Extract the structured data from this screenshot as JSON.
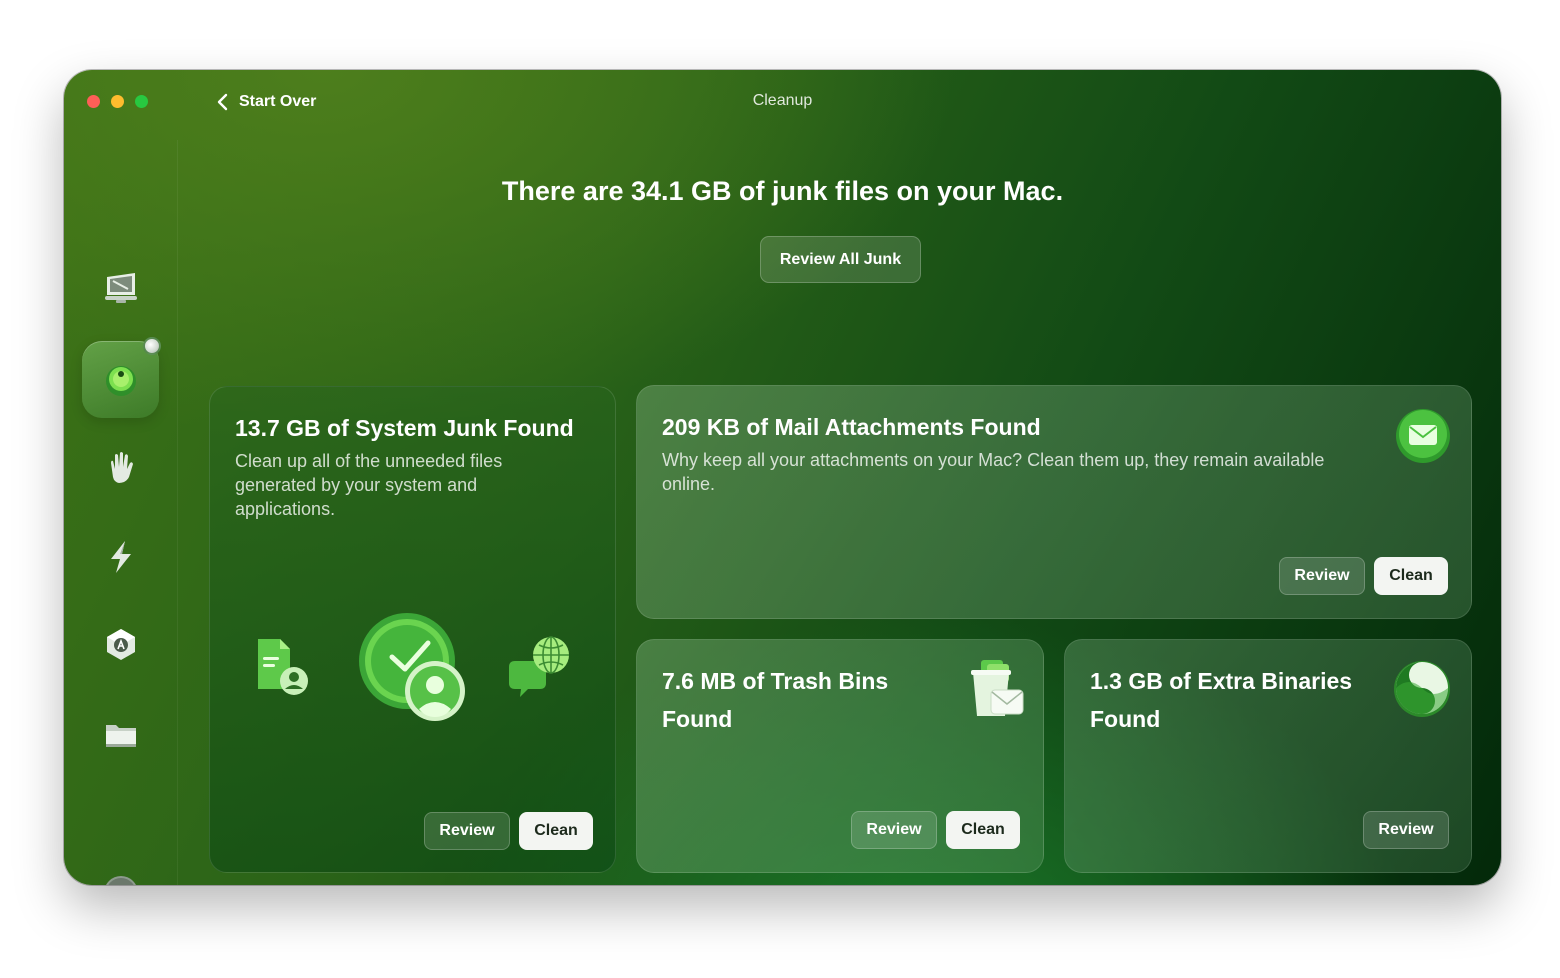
{
  "window": {
    "title": "Cleanup",
    "back_label": "Start Over"
  },
  "sidebar": {
    "items": [
      {
        "name": "system-overview-icon"
      },
      {
        "name": "cleanup-icon",
        "active": true
      },
      {
        "name": "protection-icon"
      },
      {
        "name": "performance-icon"
      },
      {
        "name": "applications-icon"
      },
      {
        "name": "files-icon"
      },
      {
        "name": "assistant-icon"
      }
    ]
  },
  "header": {
    "headline": "There are 34.1 GB of junk files on your Mac.",
    "review_all_label": "Review All Junk"
  },
  "cards": {
    "system_junk": {
      "title": "13.7 GB of System Junk Found",
      "description": "Clean up all of the unneeded files generated by your system and applications.",
      "review_label": "Review",
      "clean_label": "Clean"
    },
    "mail_attachments": {
      "title": "209 KB of Mail Attachments Found",
      "description": "Why keep all your attachments on your Mac? Clean them up, they remain available online.",
      "review_label": "Review",
      "clean_label": "Clean"
    },
    "trash_bins": {
      "title": "7.6 MB of Trash Bins Found",
      "review_label": "Review",
      "clean_label": "Clean"
    },
    "extra_binaries": {
      "title": "1.3 GB of Extra Binaries Found",
      "review_label": "Review"
    }
  },
  "colors": {
    "accent_green": "#3fae3a",
    "background_dark": "#03290a",
    "background_light": "#4d7e1c"
  }
}
